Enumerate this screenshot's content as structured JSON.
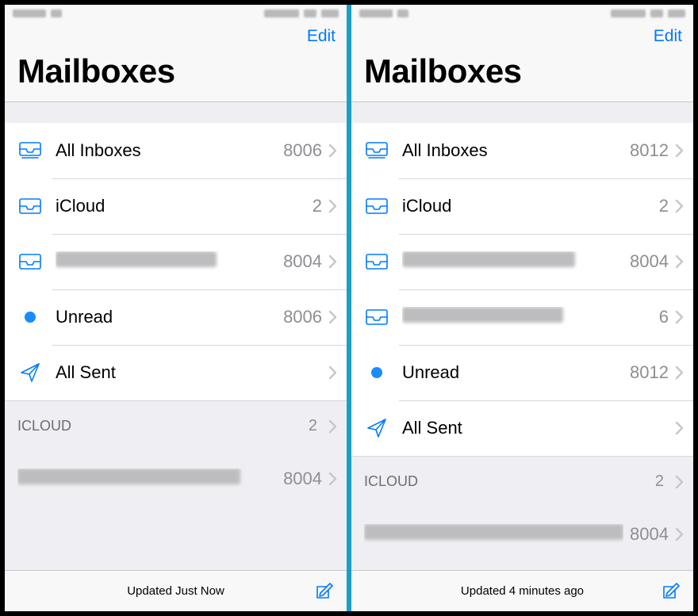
{
  "left": {
    "edit": "Edit",
    "title": "Mailboxes",
    "items": [
      {
        "icon": "allinboxes",
        "label": "All Inboxes",
        "count": "8006"
      },
      {
        "icon": "inbox",
        "label": "iCloud",
        "count": "2"
      },
      {
        "icon": "inbox",
        "label": "█████████████",
        "count": "8004",
        "redacted": true
      },
      {
        "icon": "unread",
        "label": "Unread",
        "count": "8006"
      },
      {
        "icon": "sent",
        "label": "All Sent",
        "count": ""
      }
    ],
    "section": {
      "label": "ICLOUD",
      "count": "2"
    },
    "account": {
      "label": "██████████████████",
      "count": "8004",
      "redacted": true
    },
    "status": "Updated Just Now"
  },
  "right": {
    "edit": "Edit",
    "title": "Mailboxes",
    "items": [
      {
        "icon": "allinboxes",
        "label": "All Inboxes",
        "count": "8012"
      },
      {
        "icon": "inbox",
        "label": "iCloud",
        "count": "2"
      },
      {
        "icon": "inbox",
        "label": "██████████████",
        "count": "8004",
        "redacted": true
      },
      {
        "icon": "inbox",
        "label": "█████████████",
        "count": "6",
        "redacted": true
      },
      {
        "icon": "unread",
        "label": "Unread",
        "count": "8012"
      },
      {
        "icon": "sent",
        "label": "All Sent",
        "count": ""
      }
    ],
    "section": {
      "label": "ICLOUD",
      "count": "2"
    },
    "account": {
      "label": "█████████████████████",
      "count": "8004",
      "redacted": true
    },
    "status": "Updated 4 minutes ago"
  }
}
